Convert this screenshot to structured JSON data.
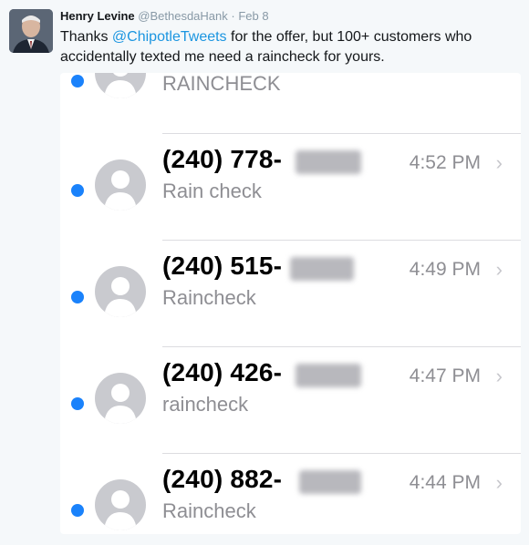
{
  "tweet": {
    "author_name": "Henry Levine",
    "handle": "@BethesdaHank",
    "separator": "·",
    "date": "Feb 8",
    "text_before": "Thanks ",
    "mention": "@ChipotleTweets",
    "text_after": " for the offer, but 100+ customers who accidentally texted me need a raincheck for yours."
  },
  "messages": [
    {
      "phone": "",
      "preview": "RAINCHECK",
      "time": ""
    },
    {
      "phone": "(240) 778-",
      "preview": "Rain check",
      "time": "4:52 PM"
    },
    {
      "phone": "(240) 515-",
      "preview": "Raincheck",
      "time": "4:49 PM"
    },
    {
      "phone": "(240) 426-",
      "preview": "raincheck",
      "time": "4:47 PM"
    },
    {
      "phone": "(240) 882-",
      "preview": "Raincheck",
      "time": "4:44 PM"
    }
  ],
  "icons": {
    "chevron": "›",
    "unread_color": "#1a82fb",
    "mention_color": "#1b95e0"
  }
}
